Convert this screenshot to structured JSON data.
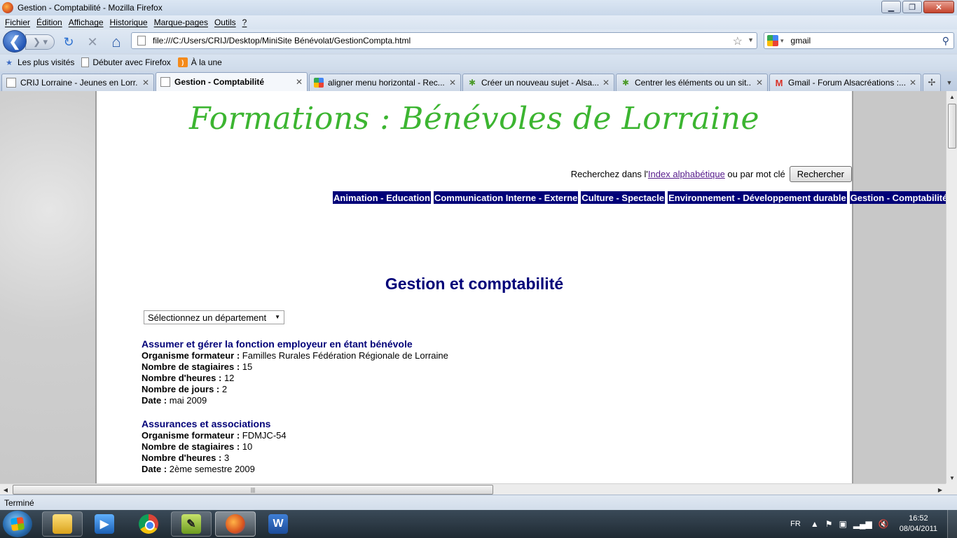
{
  "window": {
    "title": "Gestion - Comptabilité - Mozilla Firefox",
    "minimize": "▁",
    "maximize": "❐",
    "close": "✕"
  },
  "menu": [
    "Fichier",
    "Édition",
    "Affichage",
    "Historique",
    "Marque-pages",
    "Outils",
    "?"
  ],
  "nav": {
    "back_glyph": "❮",
    "forward_glyph": "❯ ▾",
    "reload_glyph": "↻",
    "stop_glyph": "✕",
    "home_glyph": "⌂",
    "url": "file:///C:/Users/CRIJ/Desktop/MiniSite Bénévolat/GestionCompta.html",
    "search_value": "gmail"
  },
  "bookmarks": [
    {
      "label": "Les plus visités",
      "icon": "star-icon"
    },
    {
      "label": "Débuter avec Firefox",
      "icon": "page-icon"
    },
    {
      "label": "À la une",
      "icon": "rss-icon"
    }
  ],
  "tabs": [
    {
      "label": "CRIJ Lorraine - Jeunes en Lorr...",
      "icon": "page-icon",
      "active": false
    },
    {
      "label": "Gestion - Comptabilité",
      "icon": "page-icon",
      "active": true
    },
    {
      "label": "aligner menu horizontal - Rec...",
      "icon": "google-icon",
      "active": false
    },
    {
      "label": "Créer un nouveau sujet - Alsa...",
      "icon": "people-icon",
      "active": false
    },
    {
      "label": "Centrer les éléments ou un sit...",
      "icon": "people-icon",
      "active": false
    },
    {
      "label": "Gmail - Forum Alsacréations :...",
      "icon": "gmail-icon",
      "active": false
    }
  ],
  "page": {
    "brand_title": "Formations : Bénévoles de Lorraine",
    "search_prefix": "Recherchez dans l'",
    "search_link": "Index alphabétique",
    "search_suffix": " ou par mot clé",
    "search_button": "Rechercher",
    "categories": [
      "Animation - Education",
      "Communication Interne - Externe",
      "Culture - Spectacle",
      "Environnement - Développement durable",
      "Gestion - Comptabilité"
    ],
    "heading": "Gestion et comptabilité",
    "department_select": "Sélectionnez un département",
    "trainings": [
      {
        "title": "Assumer et gérer la fonction employeur en étant bénévole",
        "fields": [
          {
            "label": "Organisme formateur :",
            "value": " Familles Rurales Fédération Régionale de Lorraine"
          },
          {
            "label": "Nombre de stagiaires :",
            "value": " 15"
          },
          {
            "label": "Nombre d'heures :",
            "value": " 12"
          },
          {
            "label": "Nombre de jours :",
            "value": " 2"
          },
          {
            "label": "Date :",
            "value": " mai 2009"
          }
        ]
      },
      {
        "title": "Assurances et associations",
        "fields": [
          {
            "label": "Organisme formateur :",
            "value": " FDMJC-54"
          },
          {
            "label": "Nombre de stagiaires :",
            "value": " 10"
          },
          {
            "label": "Nombre d'heures :",
            "value": " 3"
          },
          {
            "label": "Date :",
            "value": " 2ème semestre 2009"
          }
        ]
      }
    ]
  },
  "status": "Terminé",
  "taskbar": {
    "lang": "FR",
    "time": "16:52",
    "date": "08/04/2011"
  },
  "colors": {
    "brand_green": "#3cb531",
    "nav_blue": "#000078"
  }
}
